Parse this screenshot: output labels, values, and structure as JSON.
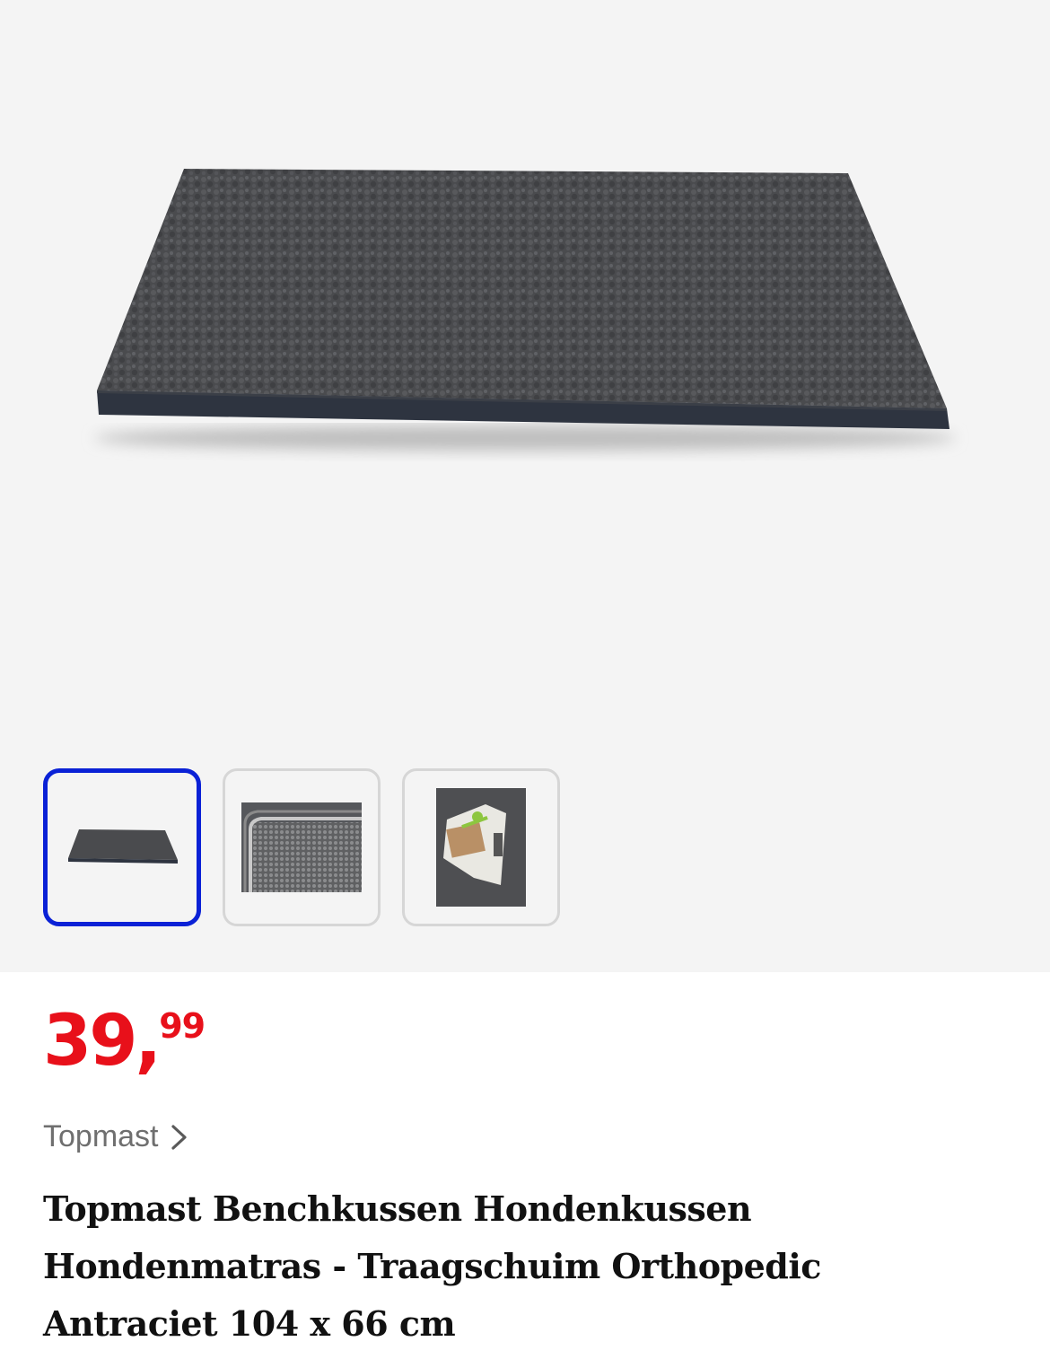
{
  "gallery": {
    "main_image": "product-photo-dog-mattress",
    "thumbnails": [
      {
        "name": "thumbnail-mattress",
        "selected": true
      },
      {
        "name": "thumbnail-zipper-detail",
        "selected": false
      },
      {
        "name": "thumbnail-label-packaging",
        "selected": false
      }
    ],
    "accent_color": "#0a21d6"
  },
  "product": {
    "price_whole": "39,",
    "price_cents": "99",
    "price_color": "#e8101a",
    "brand": "Topmast",
    "title": "Topmast Benchkussen Hondenkussen Hondenmatras - Traagschuim Orthopedic Antraciet 104 x 66 cm"
  },
  "icons": {
    "brand_chevron": "chevron-right-icon"
  }
}
